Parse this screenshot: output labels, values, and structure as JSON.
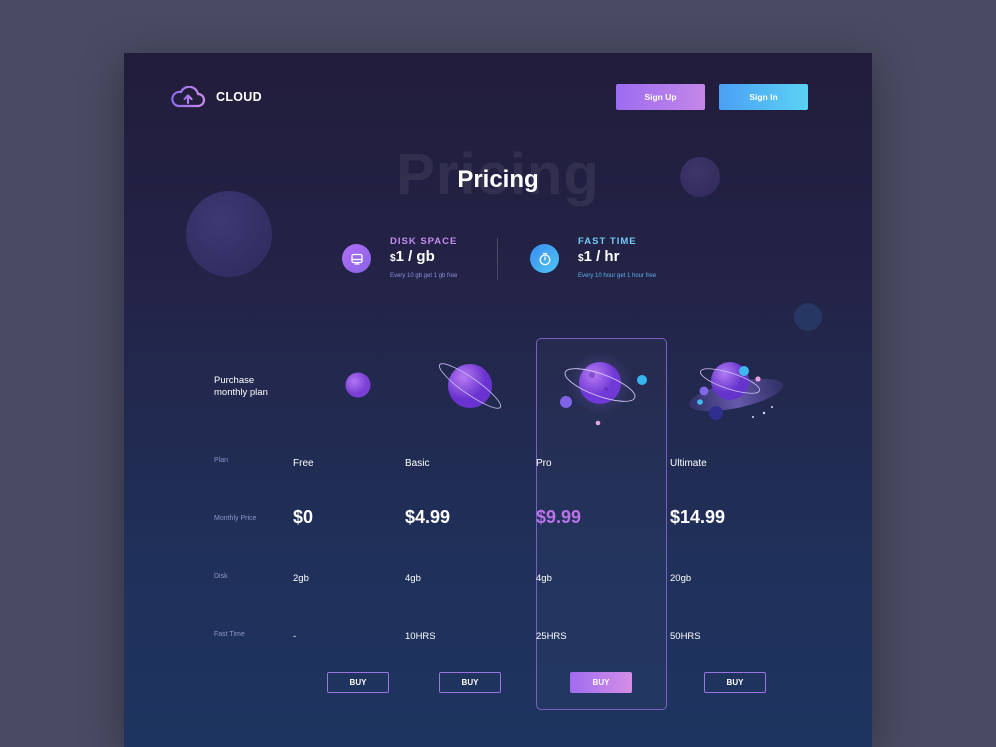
{
  "brand": {
    "name": "CLOUD"
  },
  "nav": {
    "signup_label": "Sign Up",
    "signin_label": "Sign In"
  },
  "page": {
    "title": "Pricing",
    "title_shadow": "Pricing"
  },
  "features": [
    {
      "label": "DISK SPACE",
      "currency": "$",
      "price": "1 / gb",
      "note": "Every 10 gb get 1 gb free",
      "icon": "disk-icon",
      "color": "#c58bf0"
    },
    {
      "label": "FAST TIME",
      "currency": "$",
      "price": "1 / hr",
      "note": "Every 10 hour get 1 hour free",
      "icon": "stopwatch-icon",
      "color": "#71c8f4"
    }
  ],
  "table": {
    "intro": "Purchase monthly plan",
    "row_labels": {
      "plan": "Plan",
      "price": "Monthly Price",
      "disk": "Disk",
      "fast_time": "Fast Time"
    },
    "plans": [
      {
        "name": "Free",
        "price": "$0",
        "disk": "2gb",
        "fast_time": "-",
        "buy": "BUY"
      },
      {
        "name": "Basic",
        "price": "$4.99",
        "disk": "4gb",
        "fast_time": "10HRS",
        "buy": "BUY"
      },
      {
        "name": "Pro",
        "price": "$9.99",
        "disk": "4gb",
        "fast_time": "25HRS",
        "buy": "BUY",
        "highlighted": true,
        "highlight_color": "#b873ea"
      },
      {
        "name": "Ultimate",
        "price": "$14.99",
        "disk": "20gb",
        "fast_time": "50HRS",
        "buy": "BUY"
      }
    ]
  },
  "colors": {
    "accent_purple": "#9c6cf1",
    "accent_blue": "#4aa0f6",
    "background": "#232448"
  }
}
